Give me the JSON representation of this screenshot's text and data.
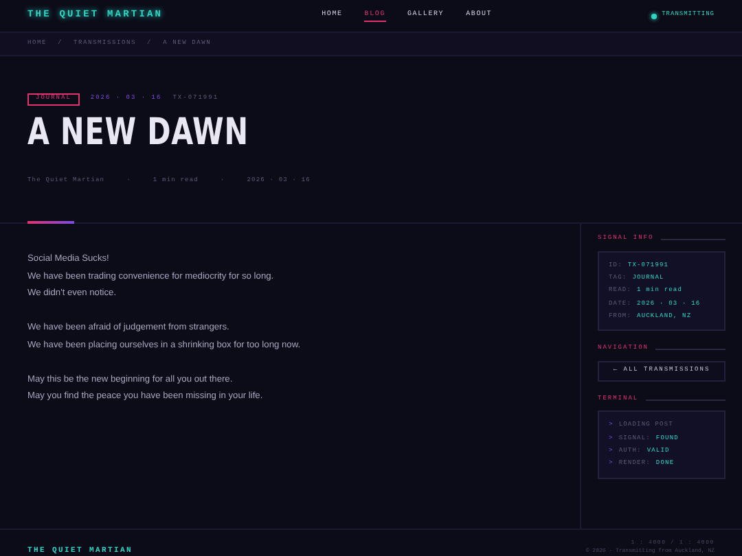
{
  "brand": "THE QUIET MARTIAN",
  "nav": [
    {
      "label": "HOME",
      "selected": false
    },
    {
      "label": "BLOG",
      "selected": true
    },
    {
      "label": "GALLERY",
      "selected": false
    },
    {
      "label": "ABOUT",
      "selected": false
    }
  ],
  "status": {
    "label": "TRANSMITTING",
    "on": true
  },
  "breadcrumb": [
    "HOME",
    "/",
    "TRANSMISSIONS",
    "/",
    "A NEW DAWN"
  ],
  "post": {
    "tag": "JOURNAL",
    "date": "2026 · 03 · 16",
    "id": "TX-071991",
    "title": "A NEW DAWN",
    "byline": [
      "The Quiet Martian",
      "·",
      "1 min read",
      "·",
      "2026 · 03 · 16"
    ],
    "paragraphs": [
      [
        "Social Media Sucks!",
        "We have been trading convenience for mediocrity for so long.",
        "We didn't even notice."
      ],
      [
        "We have been afraid of judgement from strangers.",
        "We have been placing ourselves in a shrinking box for too long now."
      ],
      [
        "May this be the new beginning for all you out there.",
        "May you find the peace you have been missing in your life."
      ]
    ]
  },
  "sidebar": {
    "signal_info": {
      "heading": "SIGNAL INFO",
      "rows": [
        {
          "key": "ID:",
          "value": "TX-071991"
        },
        {
          "key": "TAG:",
          "value": "JOURNAL"
        },
        {
          "key": "READ:",
          "value": "1 min read"
        },
        {
          "key": "DATE:",
          "value": "2026 · 03 · 16"
        },
        {
          "key": "FROM:",
          "value": "AUCKLAND, NZ"
        }
      ]
    },
    "navigation": {
      "heading": "NAVIGATION",
      "link": "← ALL TRANSMISSIONS"
    },
    "terminal": {
      "heading": "TERMINAL",
      "lines": [
        {
          "prompt": ">",
          "key": "LOADING POST"
        },
        {
          "prompt": ">",
          "key": "SIGNAL:",
          "value": "FOUND"
        },
        {
          "prompt": ">",
          "key": "AUTH:",
          "value": "VALID"
        },
        {
          "prompt": ">",
          "key": "RENDER:",
          "value": "DONE"
        }
      ]
    }
  },
  "scale": "1 : 4000 / 1 : 4000",
  "footer": {
    "brand": "THE QUIET MARTIAN",
    "note": "© 2026 · Transmitting from Auckland, NZ"
  }
}
